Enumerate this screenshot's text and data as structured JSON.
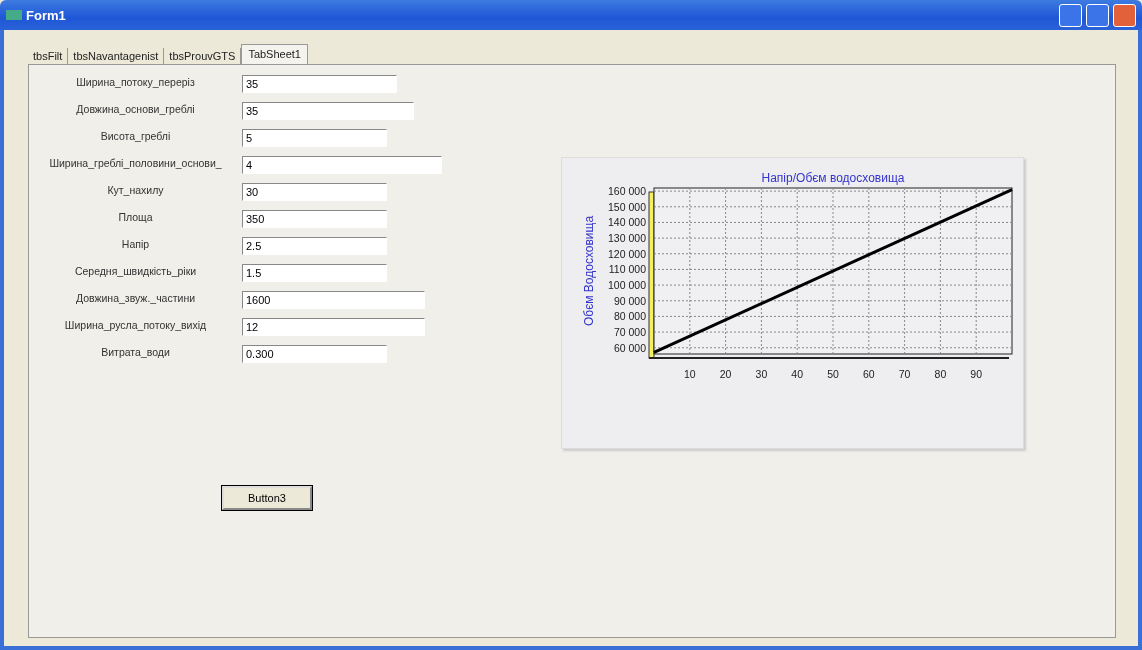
{
  "window": {
    "title": "Form1"
  },
  "tabs": [
    {
      "label": "tbsFilt",
      "selected": false
    },
    {
      "label": "tbsNavantagenist",
      "selected": false
    },
    {
      "label": "tbsProuvGTS",
      "selected": false
    },
    {
      "label": "TabSheet1",
      "selected": true
    }
  ],
  "fields": [
    {
      "label": "Ширина_потоку_перерiз",
      "value": "35"
    },
    {
      "label": "Довжина_основи_греблi",
      "value": "35"
    },
    {
      "label": "Висота_греблi",
      "value": "5"
    },
    {
      "label": "Ширина_греблi_половини_основи_",
      "value": "4"
    },
    {
      "label": "Кут_нахилу",
      "value": "30"
    },
    {
      "label": "Площа",
      "value": "350"
    },
    {
      "label": "Напiр",
      "value": "2.5"
    },
    {
      "label": "Середня_швидкiсть_рiки",
      "value": "1.5"
    },
    {
      "label": "Довжина_звуж._частини",
      "value": "1600"
    },
    {
      "label": "Ширина_русла_потоку_вихiд",
      "value": "12"
    },
    {
      "label": "Витрата_води",
      "value": "0.300"
    }
  ],
  "button": {
    "label": "Button3"
  },
  "chart": {
    "chart_data": {
      "type": "line",
      "title": "Напiр/Обєм водосховища",
      "ylabel": "Обєм Водосховища",
      "x": [
        0,
        100
      ],
      "series": [
        {
          "color": "#000000",
          "values": [
            57000,
            161000
          ]
        }
      ],
      "grid": true,
      "xlim": [
        0,
        100
      ],
      "ylim": [
        56000,
        162000
      ],
      "xticks": [
        10,
        20,
        30,
        40,
        50,
        60,
        70,
        80,
        90
      ],
      "yticks": [
        {
          "value": 60000,
          "label": "60 000"
        },
        {
          "value": 70000,
          "label": "70 000"
        },
        {
          "value": 80000,
          "label": "80 000"
        },
        {
          "value": 90000,
          "label": "90 000"
        },
        {
          "value": 100000,
          "label": "100 000"
        },
        {
          "value": 110000,
          "label": "110 000"
        },
        {
          "value": 120000,
          "label": "120 000"
        },
        {
          "value": 130000,
          "label": "130 000"
        },
        {
          "value": 140000,
          "label": "140 000"
        },
        {
          "value": 150000,
          "label": "150 000"
        },
        {
          "value": 160000,
          "label": "160 000"
        }
      ]
    }
  }
}
